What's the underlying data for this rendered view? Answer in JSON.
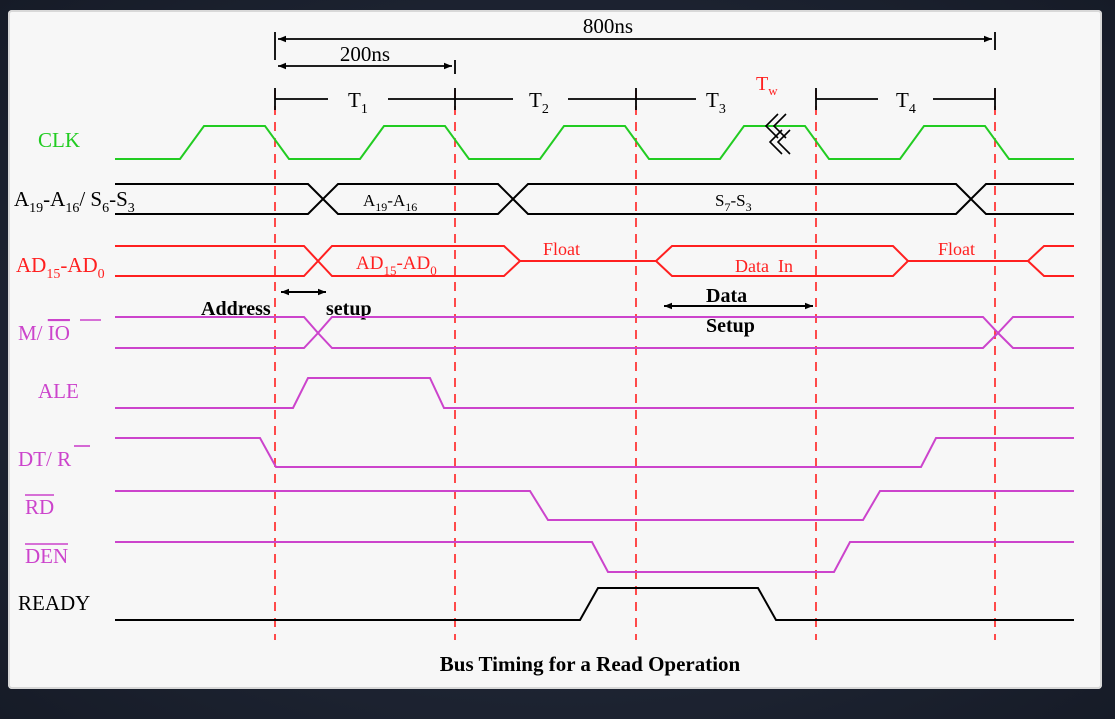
{
  "title": "Bus Timing for a Read Operation",
  "colors": {
    "clock": "#22cc22",
    "address": "#000000",
    "data_bus": "#ff2020",
    "control": "#cc44cc",
    "marker": "#ff2020",
    "ink": "#000000"
  },
  "measurements": {
    "total": "800ns",
    "single": "200ns"
  },
  "periods": {
    "t1": {
      "main": "T",
      "sub": "1"
    },
    "t2": {
      "main": "T",
      "sub": "2"
    },
    "t3": {
      "main": "T",
      "sub": "3"
    },
    "tw": {
      "main": "T",
      "sub": "w"
    },
    "t4": {
      "main": "T",
      "sub": "4"
    }
  },
  "signals": {
    "clk": {
      "label": "CLK"
    },
    "addr": {
      "a_main": "A",
      "a_sub1": "19",
      "dash": "-A",
      "a_sub2": "16",
      "slash": "/ S",
      "s_sub1": "6",
      "s_dash": "-S",
      "s_sub2": "3",
      "seg1": {
        "main": "A",
        "sub1": "19",
        "dash": "-A",
        "sub2": "16"
      },
      "seg2": {
        "main": "S",
        "sub1": "7",
        "dash": "-S",
        "sub2": "3"
      }
    },
    "ad": {
      "main": "AD",
      "sub1": "15",
      "dash": "-AD",
      "sub2": "0",
      "seg1": {
        "main": "AD",
        "sub1": "15",
        "dash": "-AD",
        "sub2": "0"
      },
      "float1": "Float",
      "data_in": "Data  In",
      "float2": "Float"
    },
    "mio": {
      "label_prefix": "M/ ",
      "label_bar": "IO"
    },
    "ale": {
      "label": "ALE"
    },
    "dtr": {
      "label_prefix": "DT/ ",
      "label_bar": "R"
    },
    "rd": {
      "label_bar": "RD"
    },
    "den": {
      "label_bar": "DEN"
    },
    "ready": {
      "label": "READY"
    }
  },
  "annotations": {
    "address": "Address",
    "setup": "setup",
    "data": "Data",
    "data_setup": "Setup"
  }
}
